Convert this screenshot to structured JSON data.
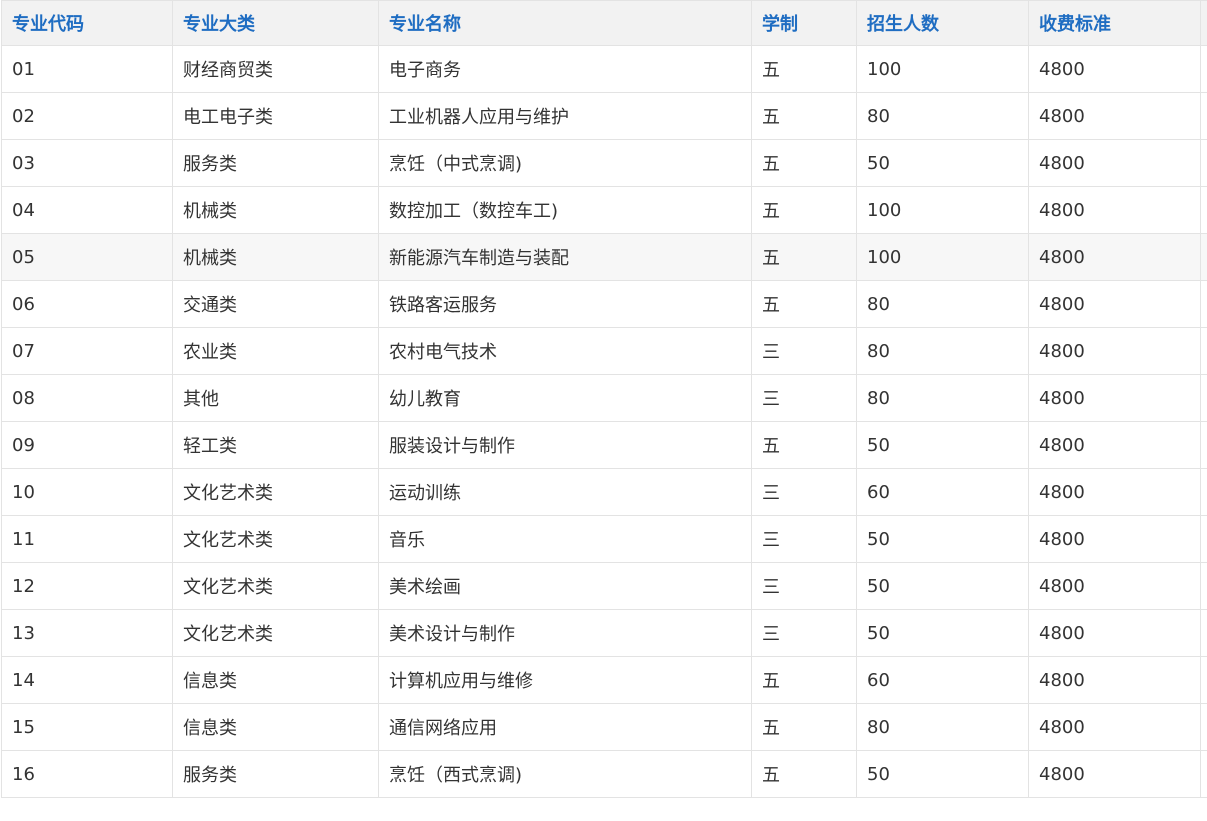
{
  "table": {
    "headers": [
      "专业代码",
      "专业大类",
      "专业名称",
      "学制",
      "招生人数",
      "收费标准"
    ],
    "rows": [
      [
        "01",
        "财经商贸类",
        "电子商务",
        "五",
        "100",
        "4800"
      ],
      [
        "02",
        "电工电子类",
        "工业机器人应用与维护",
        "五",
        "80",
        "4800"
      ],
      [
        "03",
        "服务类",
        "烹饪（中式烹调)",
        "五",
        "50",
        "4800"
      ],
      [
        "04",
        "机械类",
        "数控加工（数控车工)",
        "五",
        "100",
        "4800"
      ],
      [
        "05",
        "机械类",
        "新能源汽车制造与装配",
        "五",
        "100",
        "4800"
      ],
      [
        "06",
        "交通类",
        "铁路客运服务",
        "五",
        "80",
        "4800"
      ],
      [
        "07",
        "农业类",
        "农村电气技术",
        "三",
        "80",
        "4800"
      ],
      [
        "08",
        "其他",
        "幼儿教育",
        "三",
        "80",
        "4800"
      ],
      [
        "09",
        "轻工类",
        "服装设计与制作",
        "五",
        "50",
        "4800"
      ],
      [
        "10",
        "文化艺术类",
        "运动训练",
        "三",
        "60",
        "4800"
      ],
      [
        "11",
        "文化艺术类",
        "音乐",
        "三",
        "50",
        "4800"
      ],
      [
        "12",
        "文化艺术类",
        "美术绘画",
        "三",
        "50",
        "4800"
      ],
      [
        "13",
        "文化艺术类",
        "美术设计与制作",
        "三",
        "50",
        "4800"
      ],
      [
        "14",
        "信息类",
        "计算机应用与维修",
        "五",
        "60",
        "4800"
      ],
      [
        "15",
        "信息类",
        "通信网络应用",
        "五",
        "80",
        "4800"
      ],
      [
        "16",
        "服务类",
        "烹饪（西式烹调)",
        "五",
        "50",
        "4800"
      ]
    ],
    "highlighted_row": 4
  }
}
